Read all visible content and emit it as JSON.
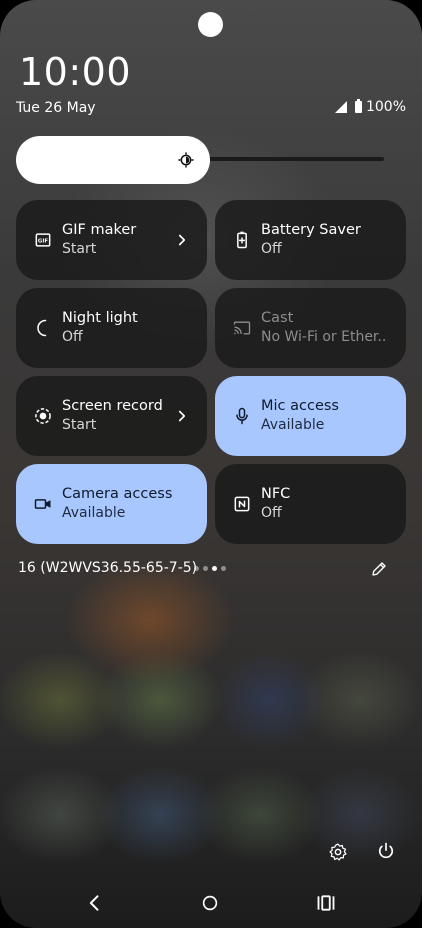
{
  "status": {
    "time": "10:00",
    "date": "Tue 26 May",
    "battery": "100%"
  },
  "brightness": {
    "level": 0.5
  },
  "tiles": [
    {
      "label": "GIF maker",
      "sub": "Start",
      "icon": "gif-icon",
      "state": "inactive",
      "has_chevron": true
    },
    {
      "label": "Battery Saver",
      "sub": "Off",
      "icon": "battery-saver-icon",
      "state": "inactive"
    },
    {
      "label": "Night light",
      "sub": "Off",
      "icon": "night-light-icon",
      "state": "inactive"
    },
    {
      "label": "Cast",
      "sub": "No Wi-Fi or Ether..",
      "icon": "cast-icon",
      "state": "unavailable"
    },
    {
      "label": "Screen record",
      "sub": "Start",
      "icon": "screen-record-icon",
      "state": "inactive",
      "has_chevron": true
    },
    {
      "label": "Mic access",
      "sub": "Available",
      "icon": "mic-icon",
      "state": "active"
    },
    {
      "label": "Camera access",
      "sub": "Available",
      "icon": "camera-icon",
      "state": "active"
    },
    {
      "label": "NFC",
      "sub": "Off",
      "icon": "nfc-icon",
      "state": "inactive"
    }
  ],
  "footer": {
    "build": "16 (W2WVS36.55-65-7-5)",
    "page_count": 4,
    "current_page": 3
  },
  "colors": {
    "active_tile": "#a9c7ff",
    "inactive_tile": "#1a1a1a"
  }
}
